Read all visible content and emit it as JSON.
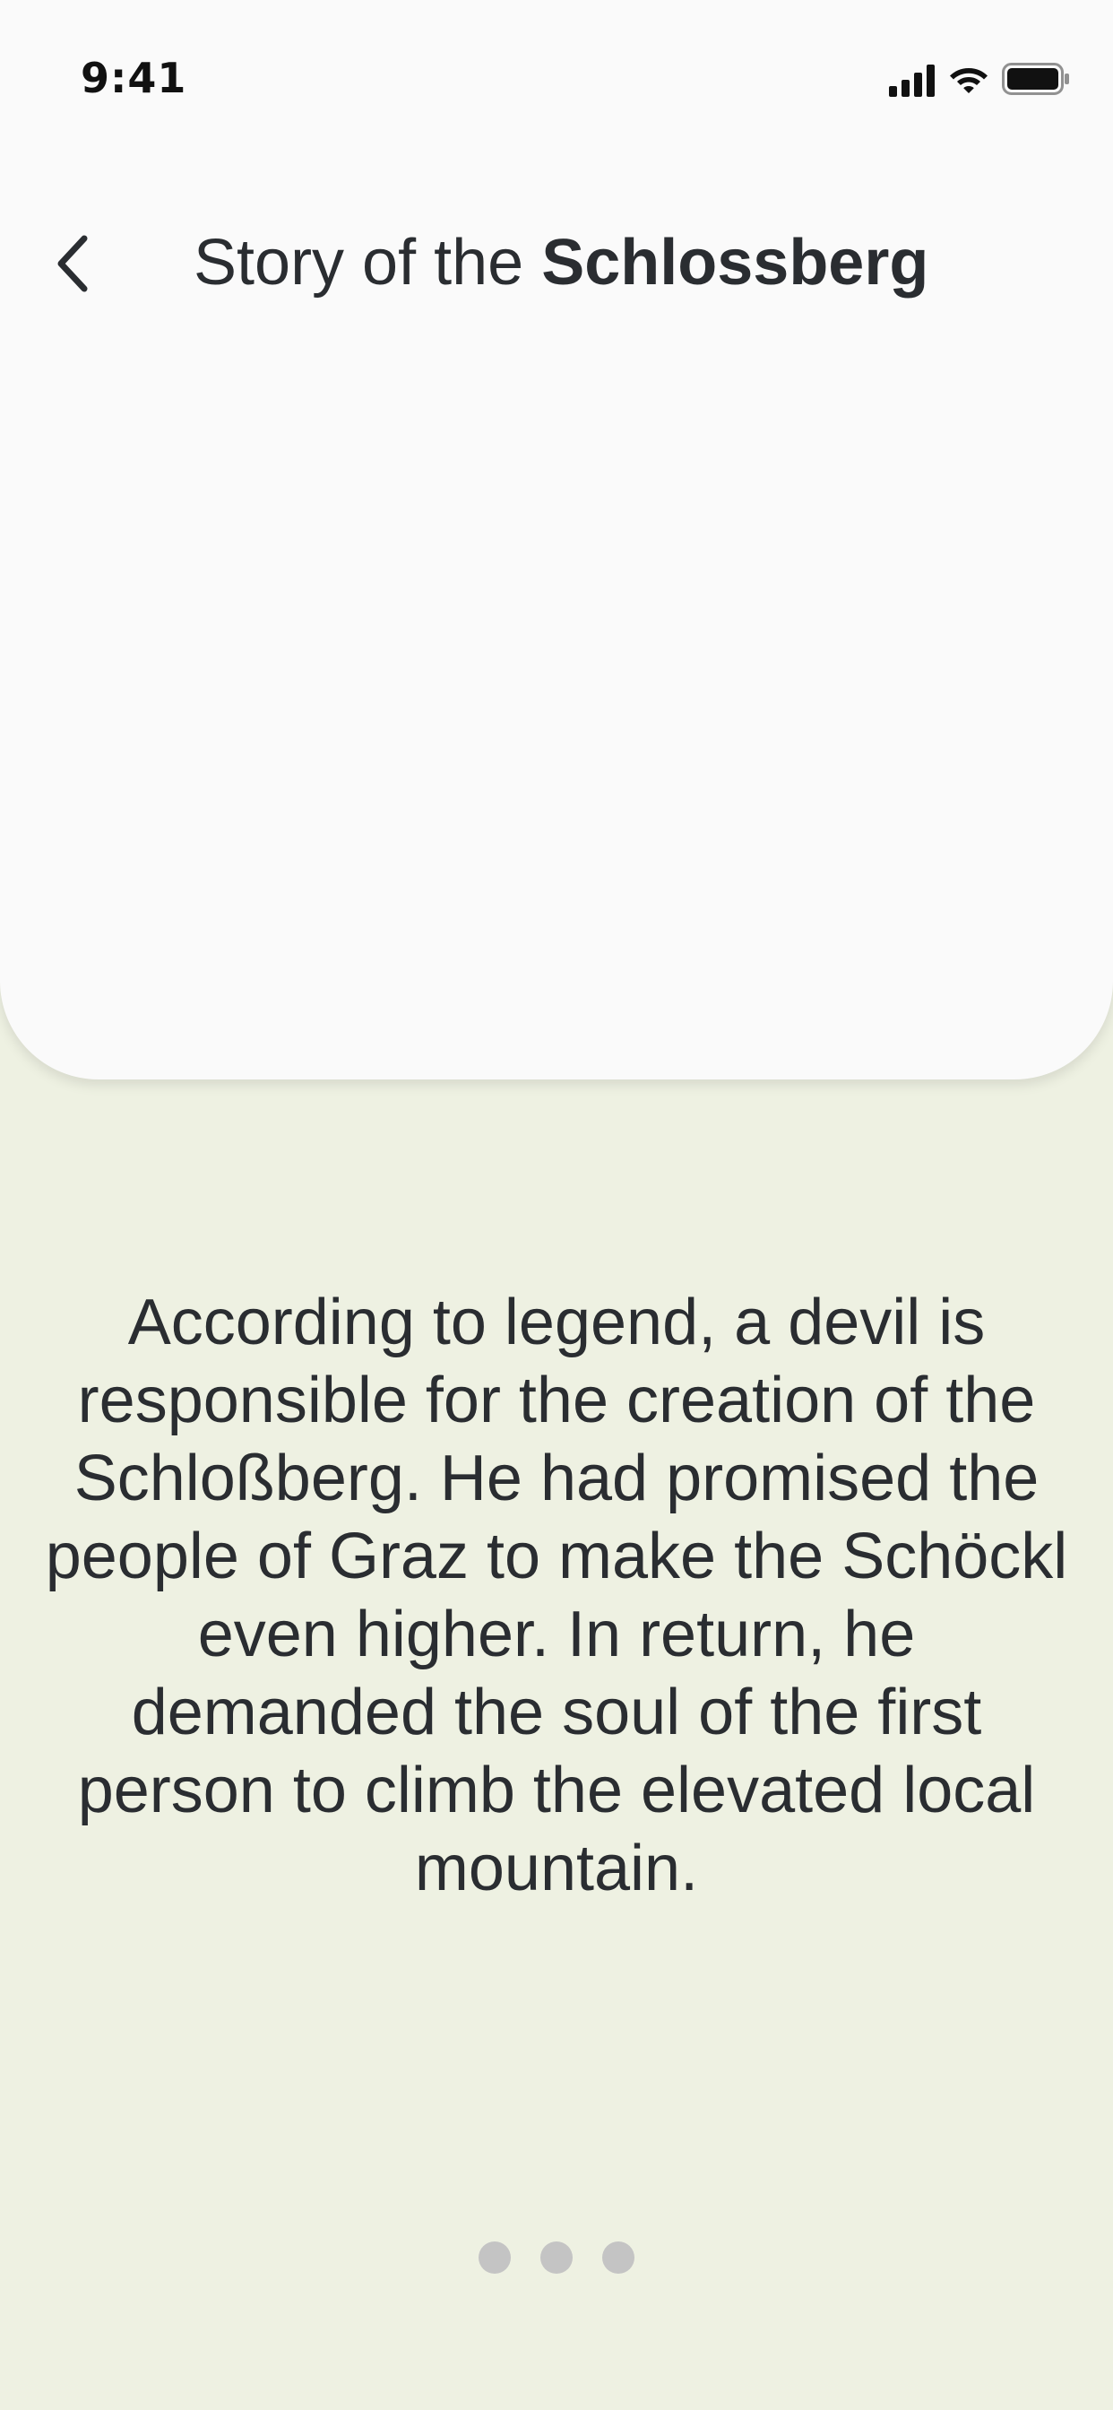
{
  "status_bar": {
    "time": "9:41",
    "icons": [
      "signal-icon",
      "wifi-icon",
      "battery-icon"
    ]
  },
  "header": {
    "back_icon": "chevron-left-icon",
    "title_prefix": "Story of the ",
    "title_emphasis": "Schlossberg"
  },
  "story": {
    "text": "According to legend, a devil is responsible for the creation of the Schloßberg. He had promised the people of Graz to make the Schöckl even higher. In return, he demanded the soul of the first person to climb the elevated local mountain."
  },
  "pager": {
    "page_count": 3
  },
  "colors": {
    "background": "#eef1e2",
    "card": "#fafafa",
    "text": "#2a2d31",
    "dot": "#c4c4c4"
  }
}
